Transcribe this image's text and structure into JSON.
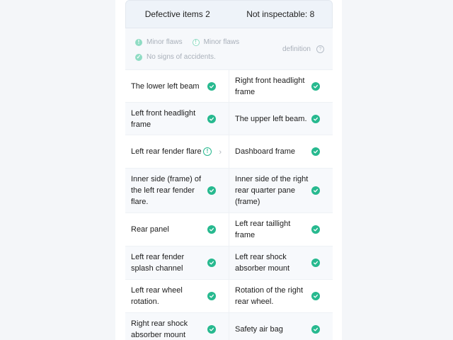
{
  "tabs": [
    {
      "label": "Defective items 2"
    },
    {
      "label": "Not inspectable: 8"
    }
  ],
  "legend": {
    "minor_flaws_1": "Minor flaws",
    "minor_flaws_2": "Minor flaws",
    "no_accidents": "No signs of accidents.",
    "definition": "definition"
  },
  "rows": [
    {
      "left": "The lower left beam",
      "left_status": "ok",
      "right": "Right front headlight frame",
      "right_status": "ok"
    },
    {
      "left": "Left front headlight frame",
      "left_status": "ok",
      "right": "The upper left beam.",
      "right_status": "ok"
    },
    {
      "left": "Left rear fender flare",
      "left_status": "warn",
      "right": "Dashboard frame",
      "right_status": "ok"
    },
    {
      "left": "Inner side (frame) of the left rear fender flare.",
      "left_status": "ok",
      "right": "Inner side of the right rear quarter pane (frame)",
      "right_status": "ok"
    },
    {
      "left": "Rear panel",
      "left_status": "ok",
      "right": "Left rear taillight frame",
      "right_status": "ok"
    },
    {
      "left": "Left rear fender splash channel",
      "left_status": "ok",
      "right": "Left rear shock absorber mount",
      "right_status": "ok"
    },
    {
      "left": "Left rear wheel rotation.",
      "left_status": "ok",
      "right": "Rotation of the right rear wheel.",
      "right_status": "ok"
    },
    {
      "left": "Right rear shock absorber mount",
      "left_status": "ok",
      "right": "Safety air bag",
      "right_status": "ok"
    }
  ],
  "colors": {
    "ok": "#27b98f",
    "ok_light": "#8fdcc4"
  }
}
